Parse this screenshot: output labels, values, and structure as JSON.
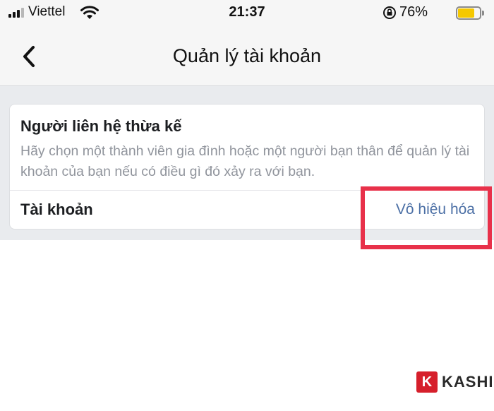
{
  "status_bar": {
    "carrier": "Viettel",
    "time": "21:37",
    "battery_percent": "76%",
    "battery_level": 0.76,
    "icons": [
      "signal-icon",
      "wifi-icon",
      "rotation-lock-icon",
      "battery-icon"
    ],
    "battery_color": "#f5c800"
  },
  "nav": {
    "title": "Quản lý tài khoản",
    "back_icon": "chevron-left-icon"
  },
  "card": {
    "legacy_contact": {
      "title": "Người liên hệ thừa kế",
      "description": "Hãy chọn một thành viên gia đình hoặc một người bạn thân để quản lý tài khoản của bạn nếu có điều gì đó xảy ra với bạn."
    },
    "account": {
      "label": "Tài khoản",
      "action": "Vô hiệu hóa",
      "action_color": "#4b6fa5"
    }
  },
  "annotation": {
    "highlight_color": "#e8314a"
  },
  "watermark": {
    "letter": "K",
    "text": "KASHI"
  }
}
